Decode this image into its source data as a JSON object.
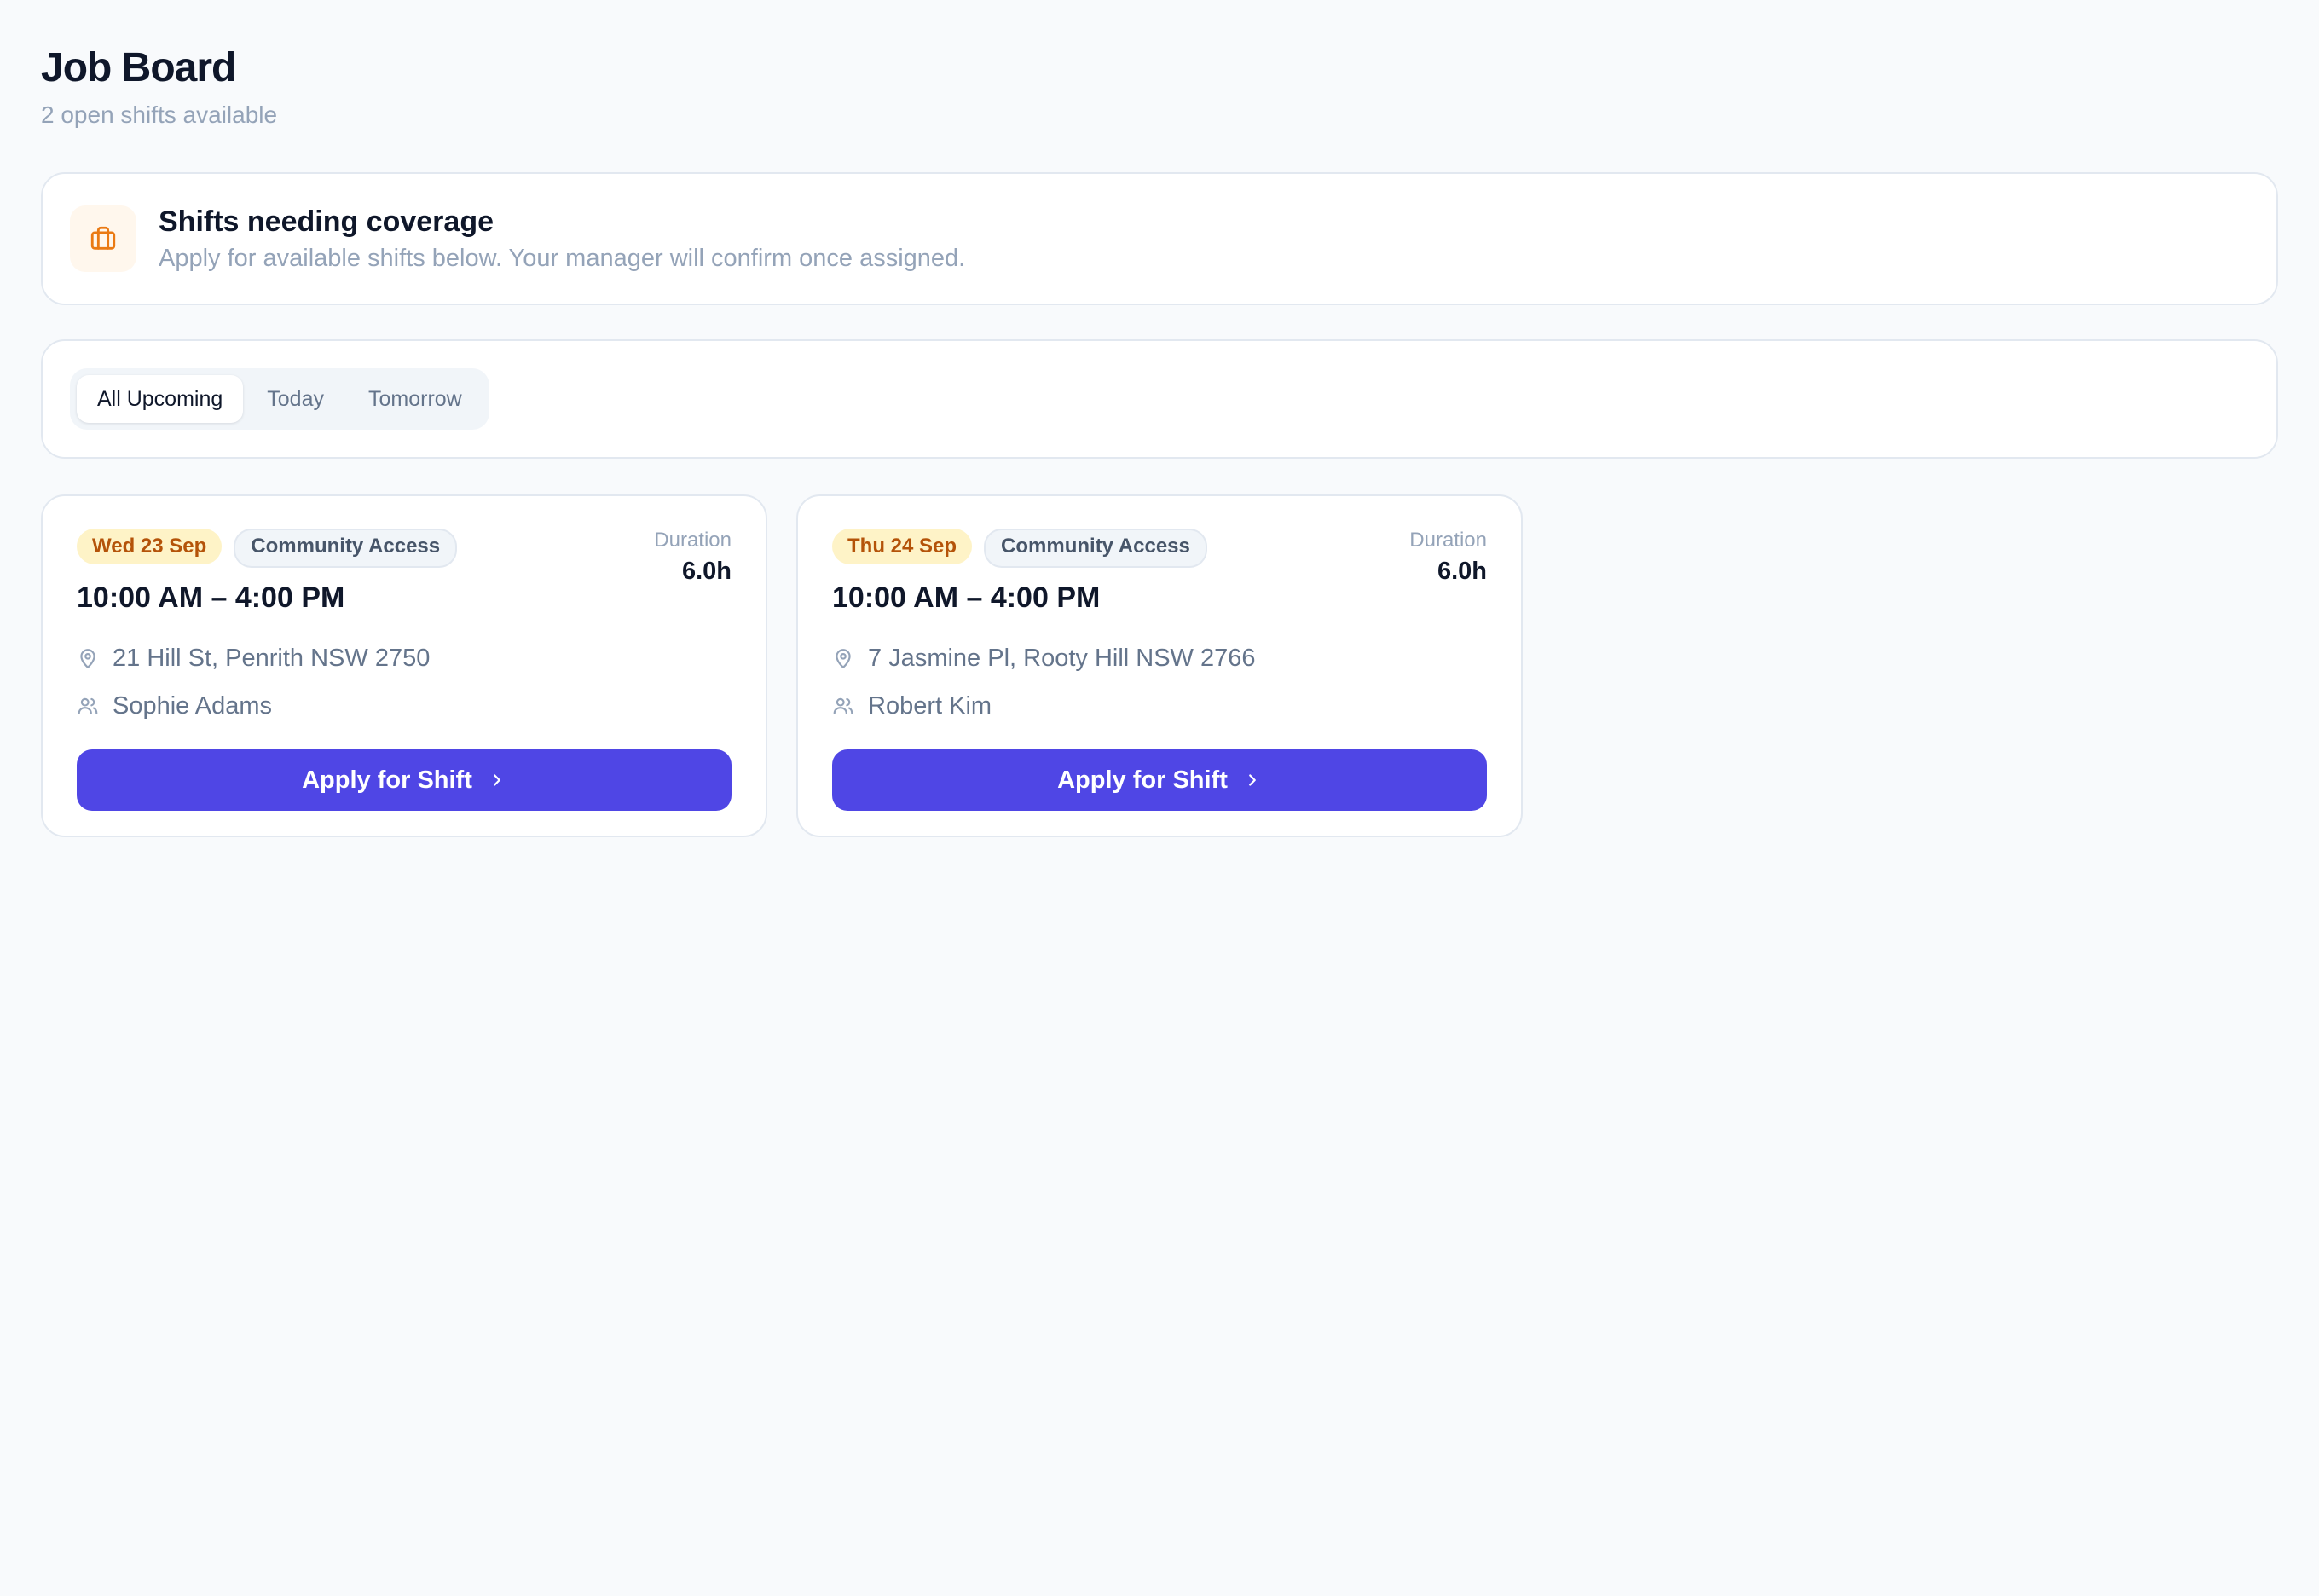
{
  "header": {
    "title": "Job Board",
    "subtitle": "2 open shifts available"
  },
  "coverage": {
    "icon": "briefcase-icon",
    "title": "Shifts needing coverage",
    "description": "Apply for available shifts below. Your manager will confirm once assigned."
  },
  "filters": {
    "tabs": [
      {
        "label": "All Upcoming",
        "active": true
      },
      {
        "label": "Today",
        "active": false
      },
      {
        "label": "Tomorrow",
        "active": false
      }
    ]
  },
  "shifts": [
    {
      "date": "Wed 23 Sep",
      "type": "Community Access",
      "duration_label": "Duration",
      "duration": "6.0h",
      "time": "10:00 AM – 4:00 PM",
      "address": "21 Hill St, Penrith NSW 2750",
      "client": "Sophie Adams",
      "apply_label": "Apply for Shift"
    },
    {
      "date": "Thu 24 Sep",
      "type": "Community Access",
      "duration_label": "Duration",
      "duration": "6.0h",
      "time": "10:00 AM – 4:00 PM",
      "address": "7 Jasmine Pl, Rooty Hill NSW 2766",
      "client": "Robert Kim",
      "apply_label": "Apply for Shift"
    }
  ],
  "colors": {
    "accent": "#4f46e5",
    "date_badge_bg": "#fef3c7",
    "date_badge_text": "#b45309",
    "icon_orange": "#ea7a14"
  }
}
